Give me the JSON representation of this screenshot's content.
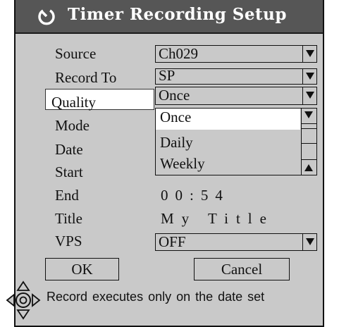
{
  "dialog": {
    "title": "Timer Recording Setup",
    "icon": "timer-icon"
  },
  "fields": {
    "source_label": "Source",
    "source_value": "Ch029",
    "record_to_label": "Record To",
    "record_to_value": "SP",
    "quality_label": "Quality",
    "quality_value": "Once",
    "mode_label": "Mode",
    "date_label": "Date",
    "start_label": "Start",
    "end_label": "End",
    "end_value": "00:54",
    "title_label": "Title",
    "title_value": "My Title",
    "vps_label": "VPS",
    "vps_value": "OFF"
  },
  "dropdown": {
    "items": [
      "Once",
      "Daily",
      "Weekly"
    ],
    "selected": "Once"
  },
  "buttons": {
    "ok": "OK",
    "cancel": "Cancel"
  },
  "hint": {
    "icon": "navigation-pad-icon",
    "text": "Record executes only on the date set"
  },
  "colors": {
    "background": "#c9c9c9",
    "titlebar": "#565656",
    "highlight": "#ffffff"
  }
}
